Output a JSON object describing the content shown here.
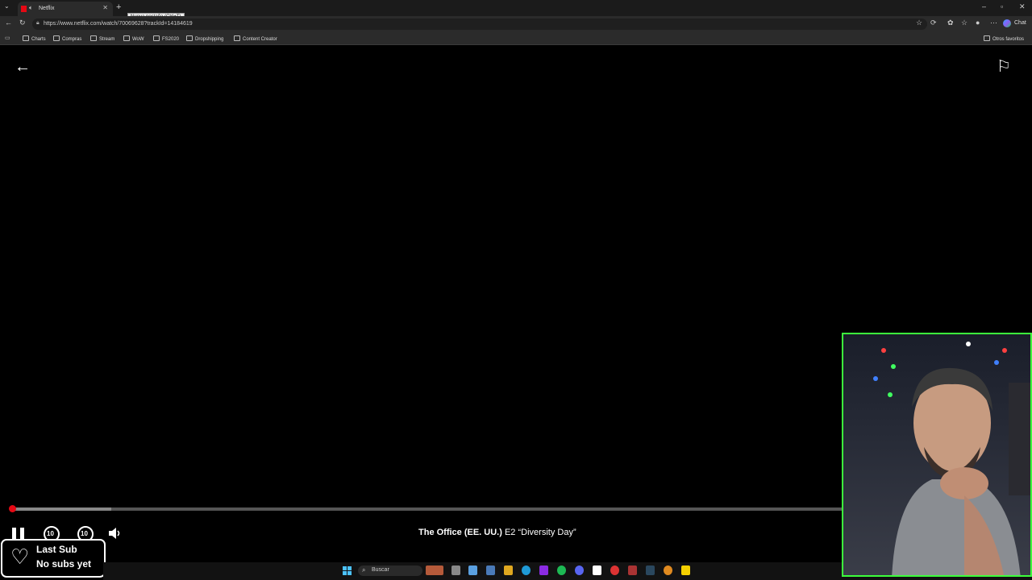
{
  "browser": {
    "tab_title": "Netflix",
    "new_tab_icon": "+",
    "tooltip": "Nueva pestaña (Ctrl+T)",
    "url": "https://www.netflix.com/watch/70069628?trackId=14184619",
    "bookmarks": [
      "Charts",
      "Compras",
      "Stream",
      "WoW",
      "FS2020",
      "Dropshipping",
      "Content Creator"
    ],
    "other_favorites": "Otros favoritos",
    "chat_label": "Chat"
  },
  "player": {
    "show": "The Office (EE. UU.)",
    "episode": "E2",
    "episode_title": "“Diversity Day”",
    "rewind_label": "10",
    "forward_label": "10",
    "progress": 0.12
  },
  "sub_widget": {
    "line1": "Last Sub",
    "line2": "No subs yet"
  },
  "taskbar": {
    "search_placeholder": "Buscar"
  }
}
